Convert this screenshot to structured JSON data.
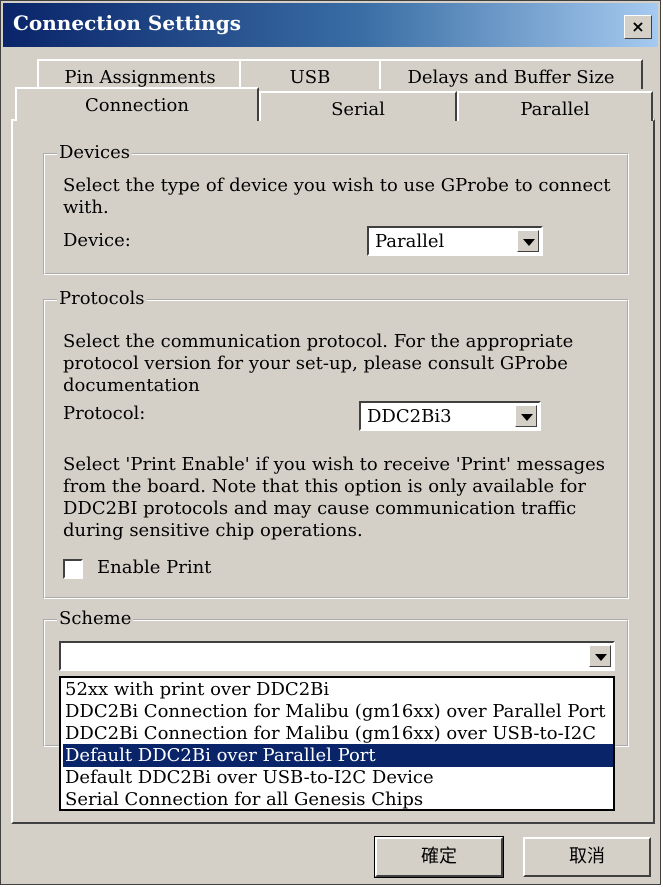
{
  "window": {
    "title": "Connection Settings",
    "close_label": "×"
  },
  "tabs_back": [
    "Pin Assignments",
    "USB",
    "Delays and Buffer Size"
  ],
  "tabs_front": [
    "Connection",
    "Serial",
    "Parallel"
  ],
  "devices": {
    "legend": "Devices",
    "description": "Select the type of device you wish to use GProbe to connect with.",
    "device_label": "Device:",
    "device_value": "Parallel"
  },
  "protocols": {
    "legend": "Protocols",
    "description": "Select the communication protocol.  For the appropriate protocol version for your set-up, please consult GProbe documentation",
    "protocol_label": "Protocol:",
    "protocol_value": "DDC2Bi3",
    "print_note": "Select 'Print Enable' if you wish to receive 'Print' messages from the board.   Note that this option is only available for DDC2BI protocols and may cause communication traffic during sensitive chip operations.",
    "enable_print_label": "Enable Print",
    "enable_print_checked": false
  },
  "scheme": {
    "legend": "Scheme",
    "value": "",
    "options": [
      "52xx with print over DDC2Bi",
      "DDC2Bi Connection for Malibu (gm16xx) over Parallel Port",
      "DDC2Bi Connection for Malibu (gm16xx) over USB-to-I2C",
      "Default DDC2Bi over Parallel Port",
      "Default DDC2Bi over USB-to-I2C Device",
      "Serial Connection for all Genesis Chips"
    ],
    "selected_index": 3
  },
  "buttons": {
    "ok": "確定",
    "cancel": "取消"
  }
}
